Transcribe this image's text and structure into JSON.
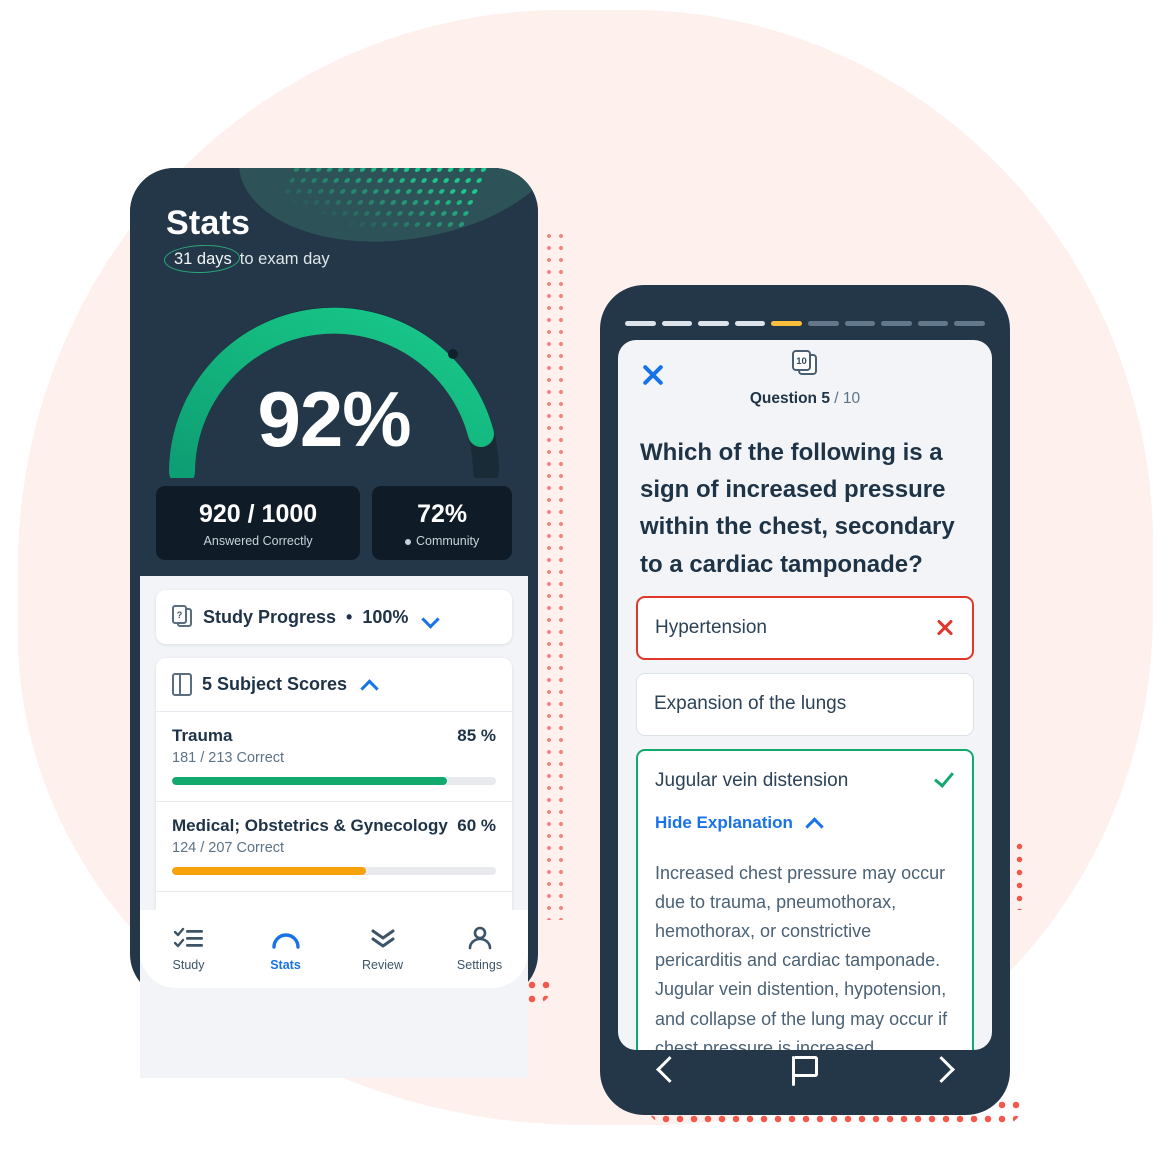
{
  "phone_stats": {
    "title": "Stats",
    "exam_badge": "31 days",
    "exam_suffix": "to exam day",
    "gauge": {
      "value": "92%",
      "percent": 92
    },
    "cards": [
      {
        "value": "920 / 1000",
        "label": "Answered Correctly",
        "has_dot": false
      },
      {
        "value": "72%",
        "label": "Community",
        "has_dot": true
      }
    ],
    "study_progress": {
      "icon": "question-cards-icon",
      "label": "Study Progress",
      "separator": "•",
      "percent": "100%",
      "chevron": "chevron-down-icon"
    },
    "subject_scores": {
      "icon": "book-icon",
      "label": "5 Subject Scores",
      "chevron": "chevron-up-icon",
      "rows": [
        {
          "name": "Trauma",
          "percent": "85 %",
          "detail": "181 / 213 Correct",
          "fill": 85,
          "color": "#11a96e"
        },
        {
          "name": "Medical; Obstetrics & Gynecology",
          "percent": "60 %",
          "detail": "124 / 207 Correct",
          "fill": 60,
          "color": "#f5a20b"
        }
      ]
    },
    "nav": [
      {
        "label": "Study",
        "icon": "checklist-icon",
        "active": false
      },
      {
        "label": "Stats",
        "icon": "gauge-icon",
        "active": true
      },
      {
        "label": "Review",
        "icon": "chevrons-down-icon",
        "active": false
      },
      {
        "label": "Settings",
        "icon": "person-icon",
        "active": false
      }
    ]
  },
  "phone_quiz": {
    "progress": {
      "total": 10,
      "completed": 4,
      "current": 5,
      "done_color": "#dce3ea",
      "current_color": "#fbbe3c",
      "todo_color": "#64788b"
    },
    "close_icon": "close-icon",
    "deck_icon_label": "10",
    "counter_current": "Question 5",
    "counter_total": "/ 10",
    "question": "Which of the following is a sign of increased pressure within the chest, secondary to a cardiac tamponade?",
    "options": [
      {
        "text": "Hypertension",
        "state": "wrong",
        "mark": "x-mark-icon"
      },
      {
        "text": "Expansion of the lungs",
        "state": "neutral",
        "mark": ""
      },
      {
        "text": "Jugular vein distension",
        "state": "correct",
        "mark": "check-mark-icon"
      }
    ],
    "hide_explanation": "Hide Explanation",
    "hide_explanation_chevron": "chevron-up-icon",
    "explanation": "Increased chest pressure may occur due to trauma, pneumothorax, hemothorax, or constrictive pericarditis and cardiac tamponade. Jugular vein distention, hypotension, and collapse of the lung may occur if chest pressure is increased.",
    "nav": [
      {
        "icon": "chevron-left-icon",
        "name": "previous-question-button"
      },
      {
        "icon": "flag-icon",
        "name": "flag-question-button"
      },
      {
        "icon": "chevron-right-icon",
        "name": "next-question-button"
      }
    ]
  },
  "colors": {
    "phone_frame": "#233749",
    "accent_blue": "#1973e8",
    "green": "#11a96e",
    "amber": "#f5a20b",
    "red": "#e0372b",
    "bg_blob": "#fdf0ed"
  }
}
